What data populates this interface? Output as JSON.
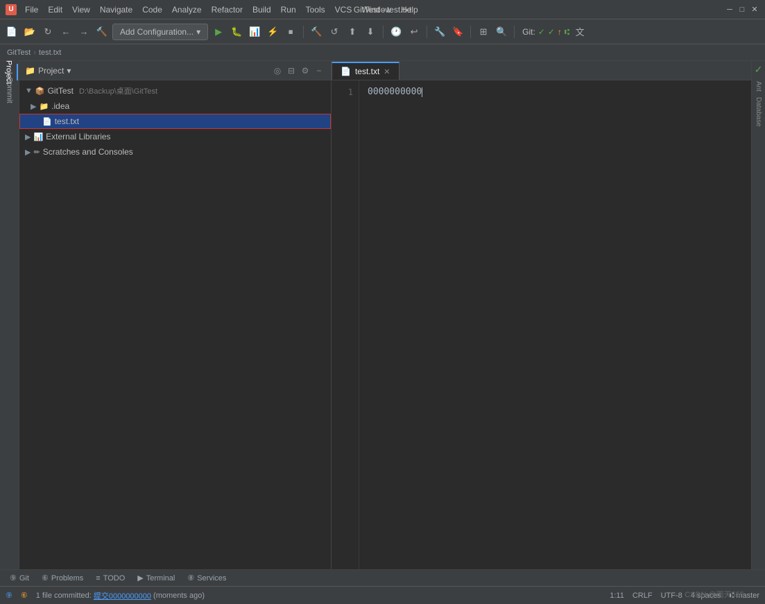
{
  "window": {
    "title": "GitTest - test.txt",
    "app_icon": "U"
  },
  "menu": {
    "items": [
      "File",
      "Edit",
      "View",
      "Navigate",
      "Code",
      "Analyze",
      "Refactor",
      "Build",
      "Run",
      "Tools",
      "VCS",
      "Window",
      "Help"
    ]
  },
  "toolbar": {
    "add_config_label": "Add Configuration...",
    "git_label": "Git:"
  },
  "breadcrumb": {
    "project": "GitTest",
    "sep1": "›",
    "file": "test.txt"
  },
  "project_panel": {
    "title": "Project",
    "root": {
      "name": "GitTest",
      "path": "D:\\Backup\\桌面\\GitTest"
    },
    "items": [
      {
        "label": ".idea",
        "type": "folder",
        "indent": 2
      },
      {
        "label": "test.txt",
        "type": "file",
        "indent": 3,
        "selected": true,
        "highlighted": true
      },
      {
        "label": "External Libraries",
        "type": "folder-special",
        "indent": 1
      },
      {
        "label": "Scratches and Consoles",
        "type": "folder-special",
        "indent": 1
      }
    ]
  },
  "editor": {
    "tab_name": "test.txt",
    "line_number": "1",
    "content": "0000000000"
  },
  "right_panel": {
    "ant_label": "Ant",
    "database_label": "Database"
  },
  "bottom_tabs": [
    {
      "icon": "⑨",
      "label": "Git",
      "number": "9"
    },
    {
      "icon": "⑥",
      "label": "Problems",
      "number": "6"
    },
    {
      "icon": "≡",
      "label": "TODO"
    },
    {
      "icon": "▶",
      "label": "Terminal"
    },
    {
      "icon": "⑧",
      "label": "Services",
      "number": "8"
    }
  ],
  "status_bar": {
    "commit_text": "1 file committed: 提交0000000000 (moments ago)",
    "position": "1:11",
    "line_ending": "CRLF",
    "encoding": "UTF-8",
    "indent": "4 spaces",
    "branch": "master"
  }
}
